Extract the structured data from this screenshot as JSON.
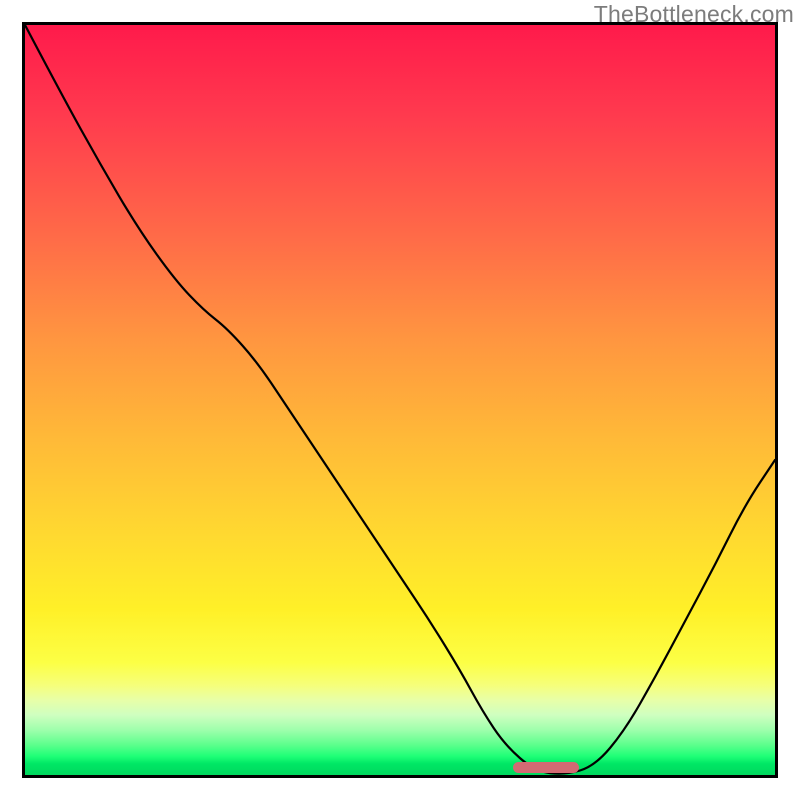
{
  "watermark": "TheBottleneck.com",
  "chart_data": {
    "type": "line",
    "title": "",
    "xlabel": "",
    "ylabel": "",
    "x": [
      0.0,
      0.05,
      0.1,
      0.15,
      0.2,
      0.238,
      0.27,
      0.31,
      0.35,
      0.4,
      0.45,
      0.5,
      0.54,
      0.58,
      0.61,
      0.64,
      0.68,
      0.72,
      0.76,
      0.8,
      0.84,
      0.88,
      0.92,
      0.96,
      1.0
    ],
    "values": [
      1.0,
      0.905,
      0.815,
      0.73,
      0.66,
      0.62,
      0.595,
      0.55,
      0.49,
      0.415,
      0.34,
      0.265,
      0.205,
      0.14,
      0.085,
      0.04,
      0.005,
      0.0,
      0.012,
      0.06,
      0.13,
      0.205,
      0.28,
      0.36,
      0.42
    ],
    "xlim": [
      0,
      1
    ],
    "ylim": [
      0,
      1
    ],
    "marker": {
      "x_start": 0.65,
      "x_end": 0.738,
      "y": 0.01
    },
    "background_gradient": [
      {
        "pos": 0.0,
        "color": "#ff1a4b"
      },
      {
        "pos": 0.5,
        "color": "#ffb938"
      },
      {
        "pos": 0.85,
        "color": "#fcff45"
      },
      {
        "pos": 0.985,
        "color": "#00e765"
      }
    ]
  }
}
